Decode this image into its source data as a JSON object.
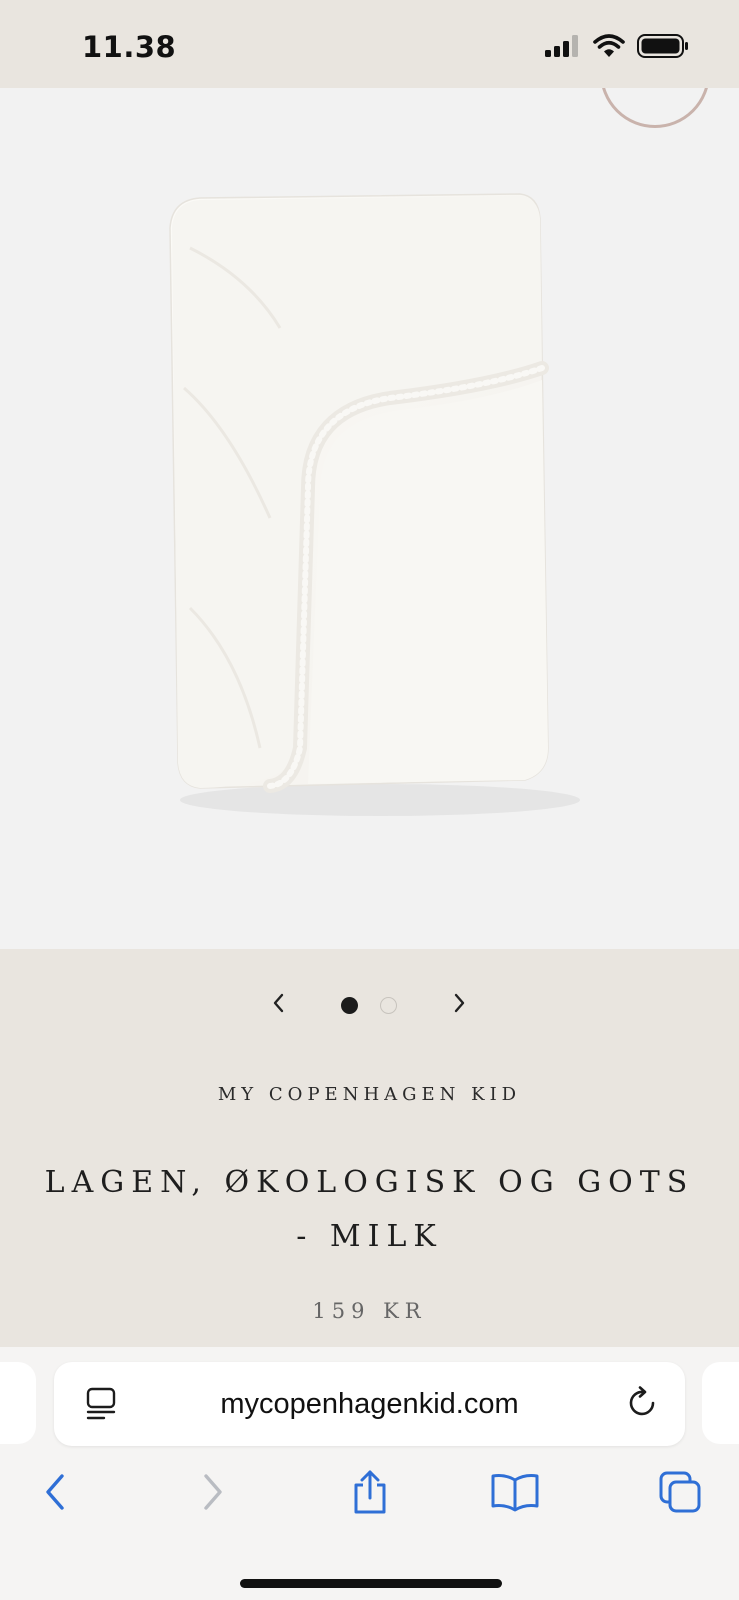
{
  "status_bar": {
    "time": "11.38",
    "icons": [
      "cellular-signal-icon",
      "wifi-icon",
      "battery-icon"
    ]
  },
  "product": {
    "image_alt": "fitted-sheet",
    "carousel": {
      "slide_count": 2,
      "active_index": 0,
      "prev_icon": "chevron-left-icon",
      "next_icon": "chevron-right-icon"
    },
    "brand": "MY COPENHAGEN KID",
    "title_line1": "LAGEN, ØKOLOGISK OG GOTS",
    "title_line2": "- MILK",
    "price": "159 KR"
  },
  "browser": {
    "url": "mycopenhagenkid.com",
    "reader_icon": "reader-mode-icon",
    "reload_icon": "reload-icon",
    "toolbar": [
      "back-icon",
      "forward-icon",
      "share-icon",
      "bookmarks-icon",
      "tabs-icon"
    ]
  },
  "colors": {
    "page_background": "#e9e5df",
    "image_background": "#f2f2f2",
    "link_blue": "#2f6fd6"
  }
}
